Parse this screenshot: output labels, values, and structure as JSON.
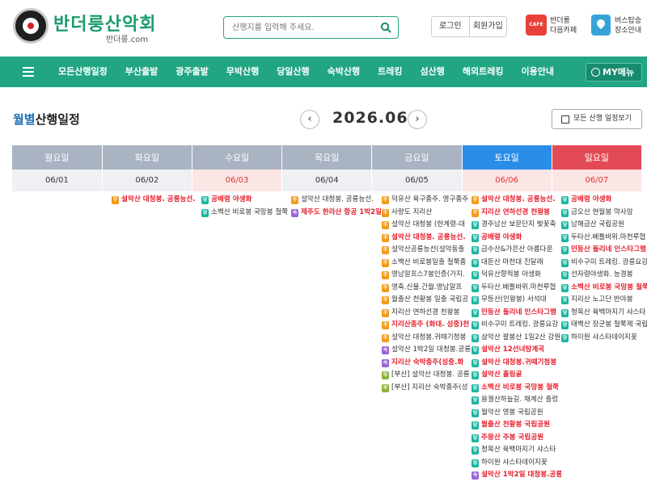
{
  "header": {
    "brand": "반더룽산악회",
    "brand_sub": "반더룽.com",
    "search_placeholder": "산행지를 입력해 주세요.",
    "login": "로그인",
    "signup": "회원가입",
    "cafe_badge": "CAFE",
    "cafe_line1": "반더룽",
    "cafe_line2": "다음카페",
    "bus_line1": "버스탑승",
    "bus_line2": "장소안내"
  },
  "nav": {
    "items": [
      "모든산행일정",
      "부산출발",
      "광주출발",
      "무박산행",
      "당일산행",
      "숙박산행",
      "트레킹",
      "섬산행",
      "해외트레킹",
      "이용안내"
    ],
    "my": "MY메뉴"
  },
  "page": {
    "title_hl": "월별",
    "title_rest": "산행일정",
    "month": "2026.06",
    "all_btn": "모든 산행 일정보기"
  },
  "calendar": {
    "weekdays": [
      "월요일",
      "화요일",
      "수요일",
      "목요일",
      "금요일",
      "토요일",
      "일요일"
    ],
    "dates": [
      "06/01",
      "06/02",
      "06/03",
      "06/04",
      "06/05",
      "06/06",
      "06/07"
    ],
    "events": [
      [],
      [
        {
          "b": "무",
          "c": "o",
          "t": "설악산 대청봉. 공룡능선.",
          "r": true
        }
      ],
      [
        {
          "b": "당",
          "c": "t",
          "t": "공배령 야생화",
          "r": true
        },
        {
          "b": "당",
          "c": "t",
          "t": "소백산 비로봉 국망봉 철쭉",
          "r": false
        }
      ],
      [
        {
          "b": "무",
          "c": "o",
          "t": "설악산 대청봉. 공룡능선.",
          "r": false
        },
        {
          "b": "숙",
          "c": "p",
          "t": "제주도 한라산 항공 1박2일",
          "r": true
        }
      ],
      [
        {
          "b": "무",
          "c": "o",
          "t": "덕유산 육구종주. 영구종주",
          "r": false
        },
        {
          "b": "무",
          "c": "o",
          "t": "사량도 지리산",
          "r": false
        },
        {
          "b": "무",
          "c": "o",
          "t": "설악산 대청봉 (한계령-대",
          "r": false
        },
        {
          "b": "무",
          "c": "o",
          "t": "설악산 대청봉. 공룡능선.",
          "r": true
        },
        {
          "b": "무",
          "c": "o",
          "t": "설악산공룡능선(설악동출",
          "r": false
        },
        {
          "b": "무",
          "c": "o",
          "t": "소백산 비로봉일출 철쭉종",
          "r": false
        },
        {
          "b": "무",
          "c": "o",
          "t": "영남알프스7봉인증(가지.",
          "r": false
        },
        {
          "b": "무",
          "c": "o",
          "t": "영축.신불.간월.영남알프",
          "r": false
        },
        {
          "b": "무",
          "c": "o",
          "t": "월출산 천황봉 일출 국립공",
          "r": false
        },
        {
          "b": "무",
          "c": "o",
          "t": "지리산 연하선경 천왕봉",
          "r": false
        },
        {
          "b": "무",
          "c": "o",
          "t": "지리산종주 (화대. 성중)천",
          "r": true
        },
        {
          "b": "무",
          "c": "o",
          "t": "설악산 대청봉.귀때기청봉",
          "r": false
        },
        {
          "b": "숙",
          "c": "p",
          "t": "설악산 1박2일 대청봉.공룡",
          "r": false
        },
        {
          "b": "숙",
          "c": "p",
          "t": "지리산 숙박종주(성중.화",
          "r": true
        },
        {
          "b": "부",
          "c": "g",
          "t": "[부산] 설악산 대청봉. 공룡",
          "r": false
        },
        {
          "b": "부",
          "c": "g",
          "t": "[부산] 지리산 숙박종주(성",
          "r": false
        }
      ],
      [
        {
          "b": "무",
          "c": "o",
          "t": "설악산 대청봉. 공룡능선.",
          "r": true
        },
        {
          "b": "무",
          "c": "o",
          "t": "지리산 연하선경 천왕봉",
          "r": true
        },
        {
          "b": "당",
          "c": "t",
          "t": "경주남산 보문단지 벚꽃축",
          "r": false
        },
        {
          "b": "당",
          "c": "t",
          "t": "공배령 야생화",
          "r": true
        },
        {
          "b": "당",
          "c": "t",
          "t": "금수산&가은산 아름다운",
          "r": false
        },
        {
          "b": "당",
          "c": "t",
          "t": "대둔산 마천대 진달래",
          "r": false
        },
        {
          "b": "당",
          "c": "t",
          "t": "덕유산향적봉 야생화",
          "r": false
        },
        {
          "b": "당",
          "c": "t",
          "t": "두타산.베틀바위.마천루협",
          "r": false
        },
        {
          "b": "당",
          "c": "t",
          "t": "무등산(인왕봉) 서석대",
          "r": false
        },
        {
          "b": "당",
          "c": "t",
          "t": "민둥산 돌리네 인스타그램",
          "r": true
        },
        {
          "b": "당",
          "c": "t",
          "t": "비수구미 트레킹. 광릉요강",
          "r": false
        },
        {
          "b": "당",
          "c": "t",
          "t": "삼악산 팔봉산 1일2산 강원",
          "r": false
        },
        {
          "b": "당",
          "c": "t",
          "t": "설악산 12선녀탕계곡",
          "r": true
        },
        {
          "b": "당",
          "c": "t",
          "t": "설악산 대청봉.귀때기청봉",
          "r": true
        },
        {
          "b": "당",
          "c": "t",
          "t": "설악산 흘림골",
          "r": true
        },
        {
          "b": "당",
          "c": "t",
          "t": "소백산 비로봉 국망봉 철쭉",
          "r": true
        },
        {
          "b": "당",
          "c": "t",
          "t": "용궐산하늘길. 채계산 출렁",
          "r": false
        },
        {
          "b": "당",
          "c": "t",
          "t": "월악산 영봉 국립공원",
          "r": false
        },
        {
          "b": "당",
          "c": "t",
          "t": "월출산 천황봉 국립공원",
          "r": true
        },
        {
          "b": "당",
          "c": "t",
          "t": "주왕산 주봉 국립공원",
          "r": true
        },
        {
          "b": "당",
          "c": "t",
          "t": "청옥산 육백마지기 샤스타",
          "r": false
        },
        {
          "b": "당",
          "c": "t",
          "t": "하이원 샤스타데이지꽃",
          "r": false
        },
        {
          "b": "숙",
          "c": "p",
          "t": "설악산 1박2일 대청봉.공룡",
          "r": true
        }
      ],
      [
        {
          "b": "당",
          "c": "t",
          "t": "공배령 야생화",
          "r": true
        },
        {
          "b": "당",
          "c": "t",
          "t": "금오산 현월봉 약사암",
          "r": false
        },
        {
          "b": "당",
          "c": "t",
          "t": "남해금산 국립공원",
          "r": false
        },
        {
          "b": "당",
          "c": "t",
          "t": "두타산.베틀바위.마천루협",
          "r": false
        },
        {
          "b": "당",
          "c": "t",
          "t": "민둥산 돌리네 인스타그램",
          "r": true
        },
        {
          "b": "당",
          "c": "t",
          "t": "비수구미 트레킹. 광릉요강",
          "r": false
        },
        {
          "b": "당",
          "c": "t",
          "t": "선자령야생화. 능경봉",
          "r": false
        },
        {
          "b": "당",
          "c": "t",
          "t": "소백산 비로봉 국망봉 철쭉",
          "r": true
        },
        {
          "b": "당",
          "c": "t",
          "t": "지리산 노고단 반야봉",
          "r": false
        },
        {
          "b": "당",
          "c": "t",
          "t": "청옥산 육백마지기 샤스타",
          "r": false
        },
        {
          "b": "당",
          "c": "t",
          "t": "태백산 장군봉 철쭉제 국립",
          "r": false
        },
        {
          "b": "당",
          "c": "t",
          "t": "하이원 샤스타데이지꽃",
          "r": false
        }
      ]
    ]
  }
}
